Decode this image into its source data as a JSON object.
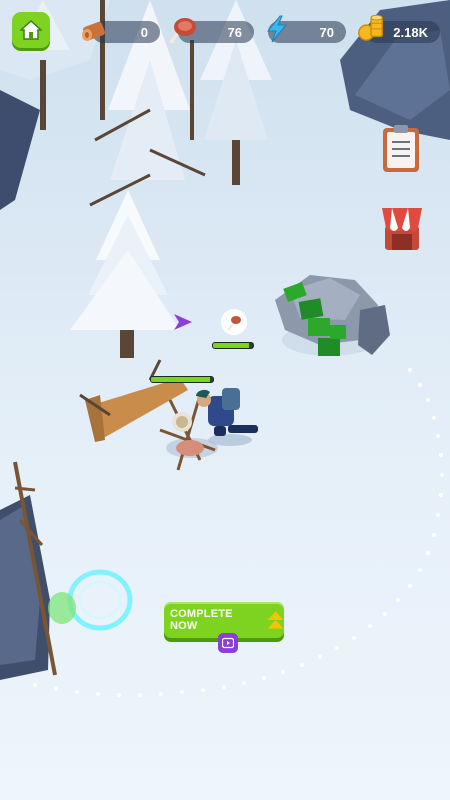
{
  "hud": {
    "wood": {
      "icon": "wood-log-icon",
      "value": "0"
    },
    "meat": {
      "icon": "meat-icon",
      "value": "76"
    },
    "energy": {
      "icon": "lightning-icon",
      "value": "70"
    },
    "coins": {
      "icon": "coin-stack-icon",
      "value": "2.18K"
    }
  },
  "side_buttons": [
    {
      "icon": "clipboard-icon"
    },
    {
      "icon": "shop-awning-icon"
    }
  ],
  "action": {
    "label": "COMPLETE NOW"
  },
  "progress": {
    "campfire": 0.95,
    "bear": 0.9
  },
  "colors": {
    "accent_green": "#7ed321",
    "video_purple": "#8b3fd8"
  }
}
